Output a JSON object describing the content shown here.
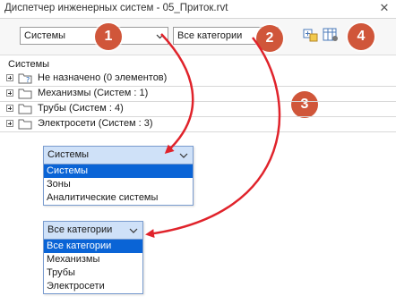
{
  "window": {
    "title": "Диспетчер инженерных систем - 05_Приток.rvt",
    "close_glyph": "✕"
  },
  "toolbar": {
    "systems_combo_value": "Системы",
    "categories_combo_value": "Все категории"
  },
  "tree": {
    "header": "Системы",
    "rows": [
      {
        "label": "Не назначено (0 элементов)",
        "icon": "unassigned-folder-icon"
      },
      {
        "label": "Механизмы (Систем : 1)",
        "icon": "folder-icon"
      },
      {
        "label": "Трубы (Систем : 4)",
        "icon": "folder-icon"
      },
      {
        "label": "Электросети (Систем : 3)",
        "icon": "folder-icon"
      }
    ]
  },
  "systems_dropdown": {
    "selected": "Системы",
    "options": [
      "Системы",
      "Зоны",
      "Аналитические системы"
    ]
  },
  "categories_dropdown": {
    "selected": "Все категории",
    "options": [
      "Все категории",
      "Механизмы",
      "Трубы",
      "Электросети"
    ]
  },
  "callouts": [
    "1",
    "2",
    "3",
    "4"
  ],
  "colors": {
    "callout": "#d0563a",
    "arrow": "#e0232b",
    "selection": "#0a64d6"
  }
}
